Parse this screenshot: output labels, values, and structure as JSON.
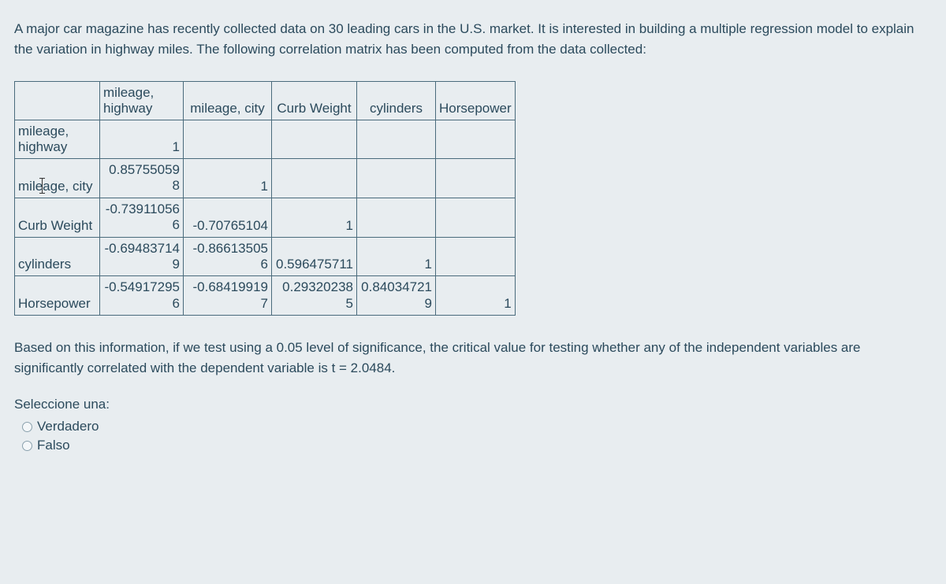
{
  "intro": "A major car magazine has recently collected data on 30 leading cars in the U.S. market. It is interested in building a multiple regression model to explain the variation in highway miles. The following correlation matrix has been computed from the data collected:",
  "table": {
    "headers": [
      "",
      "mileage, highway",
      "mileage, city",
      "Curb Weight",
      "cylinders",
      "Horsepower"
    ],
    "rows": [
      {
        "label": "mileage, highway",
        "cells": [
          "1",
          "",
          "",
          "",
          ""
        ]
      },
      {
        "label": "mileage, city",
        "cells": [
          "0.857550598",
          "1",
          "",
          "",
          ""
        ]
      },
      {
        "label": "Curb Weight",
        "cells": [
          "-0.739110566",
          "-0.70765104",
          "1",
          "",
          ""
        ]
      },
      {
        "label": "cylinders",
        "cells": [
          "-0.694837149",
          "-0.866135056",
          "0.596475711",
          "1",
          ""
        ]
      },
      {
        "label": "Horsepower",
        "cells": [
          "-0.549172956",
          "-0.684199197",
          "0.293202385",
          "0.840347219",
          "1"
        ]
      }
    ]
  },
  "display": {
    "col1_head_line1": "mileage,",
    "col1_head_line2": "highway",
    "col2_head": "mileage, city",
    "col3_head": "Curb Weight",
    "col4_head": "cylinders",
    "col5_head": "Horsepower",
    "r1_label_line1": "mileage,",
    "r1_label_line2": "highway",
    "r2_label": "mileage, city",
    "r3_label": "Curb Weight",
    "r4_label": "cylinders",
    "r5_label": "Horsepower",
    "r1c1": "1",
    "r2c1_top": "0.85755059",
    "r2c1_bot": "8",
    "r2c2": "1",
    "r3c1_top": "-0.73911056",
    "r3c1_bot": "6",
    "r3c2": "-0.70765104",
    "r3c3": "1",
    "r4c1_top": "-0.69483714",
    "r4c1_bot": "9",
    "r4c2_top": "-0.86613505",
    "r4c2_bot": "6",
    "r4c3": "0.596475711",
    "r4c4": "1",
    "r5c1_top": "-0.54917295",
    "r5c1_bot": "6",
    "r5c2_top": "-0.68419919",
    "r5c2_bot": "7",
    "r5c3_top": "0.29320238",
    "r5c3_bot": "5",
    "r5c4_top": "0.84034721",
    "r5c4_bot": "9",
    "r5c5": "1"
  },
  "followup": "Based on this information, if we test using a 0.05 level of significance, the critical value for testing whether any of the independent variables are significantly correlated with the dependent variable is t = 2.0484.",
  "select_label": "Seleccione una:",
  "options": {
    "true": "Verdadero",
    "false": "Falso"
  }
}
